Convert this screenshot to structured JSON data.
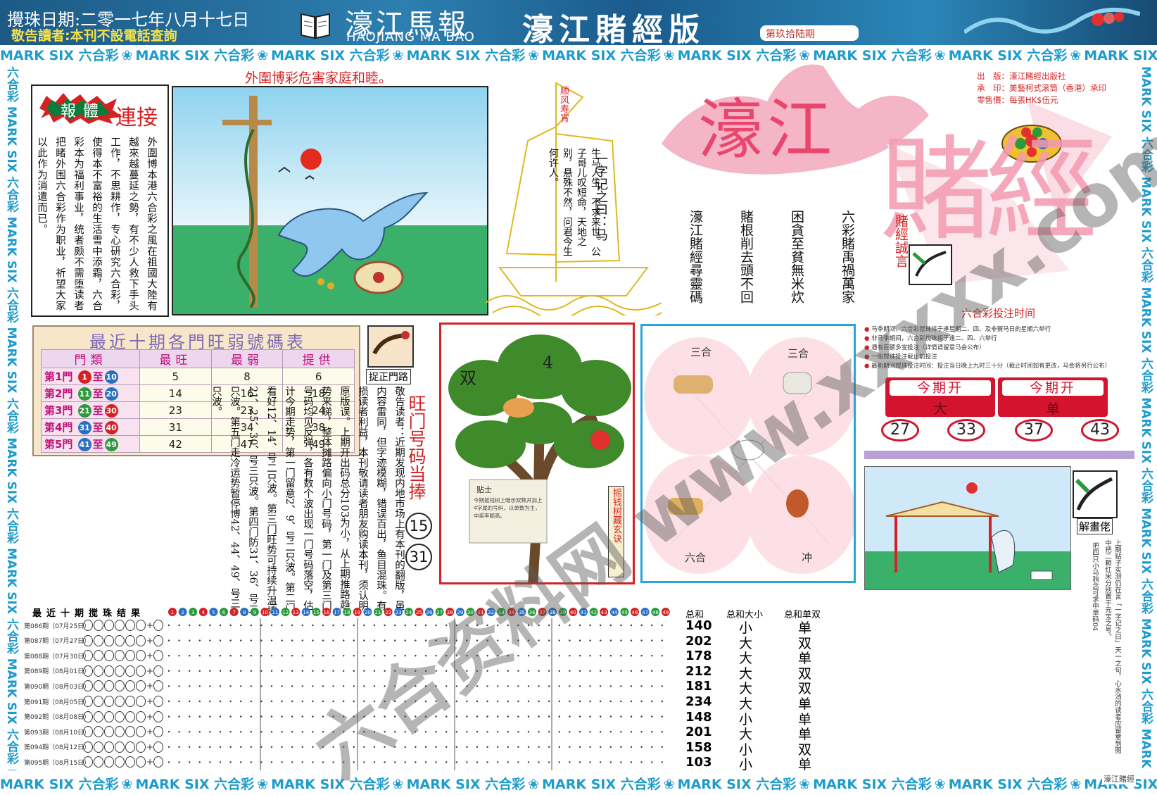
{
  "header": {
    "draw_date": "攪珠日期:二零一七年八月十七日",
    "notice": "敬告讀者:本刊不設電話查詢",
    "brand": "濠江馬報",
    "brand_en": "HAOJIANG MA BAO",
    "edition": "濠江賭經版",
    "issue": "第玖拾陆期"
  },
  "border": {
    "text": "MARK SIX 六合彩",
    "vertical_left": "六合彩 MARK SIX 六合彩 MARK SIX 六合彩 MARK SIX 六合彩 MARK SIX 六合彩 MARK SIX 六合彩 MARK SIX 六合彩 MARK SIX",
    "vertical_right": "MARK SIX 六合彩 MARK SIX 六合彩 MARK SIX 六合彩 MARK SIX 六合彩 MARK SIX 六合彩 MARK SIX 六合彩 MARK SIX 六合彩"
  },
  "slogan": "外圍博彩危害家庭和睦。",
  "links": {
    "title_1": "報",
    "title_2": "體",
    "title_3": "連接",
    "body": "外圍博本港六合彩之風在祖國大陸有越來越蔓延之勢，有不少人救下手头工作，不思耕作，专心研究六合彩，使得本不富裕的生活雪中添霜，六合彩本为福利事业，统者颇不需堕读者把睹外围六合彩作为职业，祈望大家以此作为消遣而已。"
  },
  "sailboat": {
    "flag": "顺风寿宵",
    "title": "一字记之曰：马",
    "verse": "牛马人生，不求来世。公子哥儿叹短命，天地之别，悬殊不然，问君今生何许人。"
  },
  "logo": {
    "word_1": "濠江",
    "word_2": "賭經"
  },
  "publisher": {
    "publisher_label": "出　版：",
    "publisher_value": "濠江賭經出版社",
    "printer_label": "承　印：",
    "printer_value": "美藝柯式滚筒（香港）承印",
    "price_label": "零售價：",
    "price_value": "每張HK$伍元"
  },
  "mottos": {
    "label": "賭經誠言",
    "lines": [
      "六彩賭禹禍萬家",
      "困貪至貧無米炊",
      "賭根削去頭不回",
      "濠江賭經尋靈碼"
    ]
  },
  "stats": {
    "title": "最近十期各門旺弱號碼表",
    "headers": [
      "門類",
      "最旺",
      "最弱",
      "提供"
    ],
    "to": "至",
    "rows": [
      {
        "gate": "第1門",
        "from": "1",
        "to_num": "10",
        "from_color": "#d42224",
        "to_color": "#2a6fc0",
        "hot": "5",
        "cold": "8",
        "offer": "6"
      },
      {
        "gate": "第2門",
        "from": "11",
        "to_num": "20",
        "from_color": "#2a9a3c",
        "to_color": "#2a6fc0",
        "hot": "14",
        "cold": "16",
        "offer": "18"
      },
      {
        "gate": "第3門",
        "from": "21",
        "to_num": "30",
        "from_color": "#2a9a3c",
        "to_color": "#d42224",
        "hot": "23",
        "cold": "23",
        "offer": "24"
      },
      {
        "gate": "第4門",
        "from": "31",
        "to_num": "40",
        "from_color": "#2a6fc0",
        "to_color": "#d42224",
        "hot": "31",
        "cold": "34",
        "offer": "38"
      },
      {
        "gate": "第5門",
        "from": "41",
        "to_num": "49",
        "from_color": "#2a6fc0",
        "to_color": "#2a9a3c",
        "hot": "42",
        "cold": "47",
        "offer": "49"
      }
    ]
  },
  "reminder": {
    "icon_label": "捉正門路",
    "notice": "敬告读者：近期发现内地市场上有本刊的翻版，虽内容雷同，但字迹模糊，错误百出，鱼目混珠。有损读者利益，本刊敬请读者朋友购读本刊，须认明原版误。上期开出码总分103为小，从上期推路趋势来睇，整体摊路偏向小门号码，第一门及第三门号码均见反弹，各有数个波出现一门号码落空，估计今期走势，第一门留意2、9、号二只波。第二门看好12、14、号二只波。第三门旺势可持续升温捧21、25、30、号三只波。第四门防31、36、号二只波。第五门走冷运势暂停博42、44、49、号三只波。",
    "hot_label": "旺门号码当捧",
    "hot_numbers": [
      "15",
      "31"
    ]
  },
  "tree": {
    "char_1": "双",
    "char_2": "4",
    "caption": "摇钱树藏玄诀",
    "note_title": "贴士",
    "note_body": "今期摇钱树上暗示双数并加上4字尾的号码，以单数为主，中奖率颇高。"
  },
  "zodiac": {
    "labels": [
      "三合",
      "三合",
      "六合",
      "冲"
    ]
  },
  "bet": {
    "title": "六合彩投注时间",
    "items": [
      "马季期间，六合彩搅珠将于逢星期二、四、及非赛马日的星期六举行",
      "非马季期间，六合彩搅珠将于逢二、四、六举行",
      "遇有巨额多宝投注（详情请留意马会公布）",
      "一般搅珠投注截止前投注",
      "最新期间搅珠投注时间：投注当日晚上九时三十分（截止时间如有更改，马会将另行公布）"
    ],
    "open_label": "今期开",
    "open_1": "大",
    "open_2": "单",
    "numbers": [
      "27",
      "33",
      "37",
      "43"
    ]
  },
  "solver": {
    "label": "解畫佬",
    "text_1": "上期贴子实测仍在言「一字记之曰」天一之句，心水消的读者应留意到图中把二颗红米分别置于元宝之号。",
    "text_2": "把四只小马驹念可求中单码04"
  },
  "results": {
    "title": "最近十期搅珠结果",
    "rows": [
      {
        "label": "第086期（07月25日）"
      },
      {
        "label": "第087期（07月27日）"
      },
      {
        "label": "第088期（07月30日）"
      },
      {
        "label": "第089期（08月01日）"
      },
      {
        "label": "第090期（08月03日）"
      },
      {
        "label": "第091期（08月05日）"
      },
      {
        "label": "第092期（08月08日）"
      },
      {
        "label": "第093期（08月10日）"
      },
      {
        "label": "第094期（08月12日）"
      },
      {
        "label": "第095期（08月15日）"
      }
    ],
    "plus": "+",
    "ball_numbers": [
      "1",
      "2",
      "3",
      "4",
      "5",
      "6",
      "7",
      "8",
      "9",
      "10",
      "11",
      "12",
      "13",
      "14",
      "15",
      "16",
      "17",
      "18",
      "19",
      "20",
      "21",
      "22",
      "23",
      "24",
      "25",
      "26",
      "27",
      "28",
      "29",
      "30",
      "31",
      "32",
      "33",
      "34",
      "35",
      "36",
      "37",
      "38",
      "39",
      "40",
      "41",
      "42",
      "43",
      "44",
      "45",
      "46",
      "47",
      "48",
      "49"
    ],
    "sum_headers": [
      "总和",
      "总和大小",
      "总和单双"
    ],
    "sums": [
      "140",
      "202",
      "178",
      "212",
      "181",
      "234",
      "148",
      "201",
      "158",
      "103"
    ],
    "big_small": [
      "小",
      "大",
      "大",
      "大",
      "大",
      "大",
      "小",
      "大",
      "小",
      "小"
    ],
    "odd_even": [
      "单",
      "双",
      "单",
      "双",
      "双",
      "单",
      "单",
      "单",
      "双",
      "单"
    ]
  },
  "watermark": "六合资料网 www.xxxxx.com",
  "stamp": "濠江賭經"
}
